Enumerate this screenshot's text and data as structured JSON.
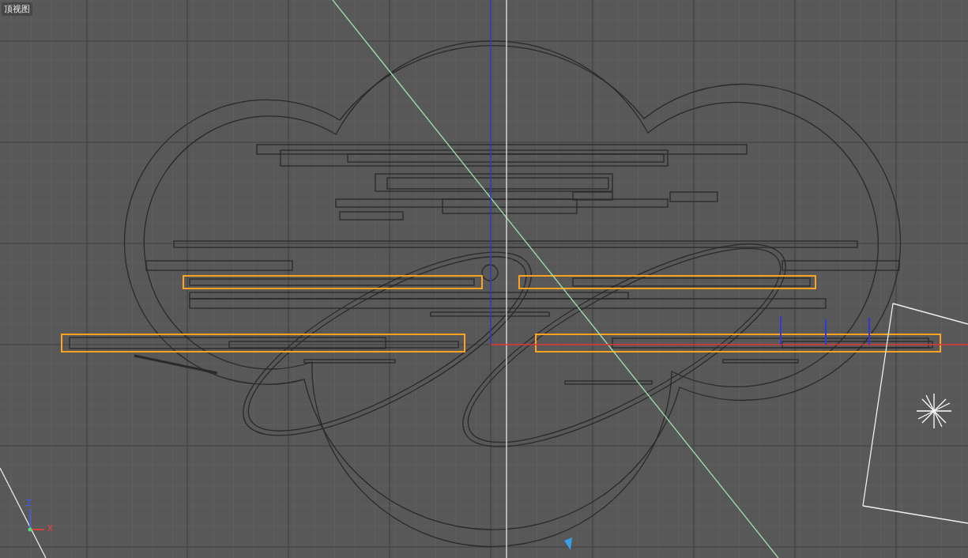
{
  "viewport": {
    "label": "顶视图",
    "axis_labels": [
      {
        "kind": "z",
        "text": "Z"
      },
      {
        "kind": "x",
        "text": "X"
      }
    ]
  }
}
